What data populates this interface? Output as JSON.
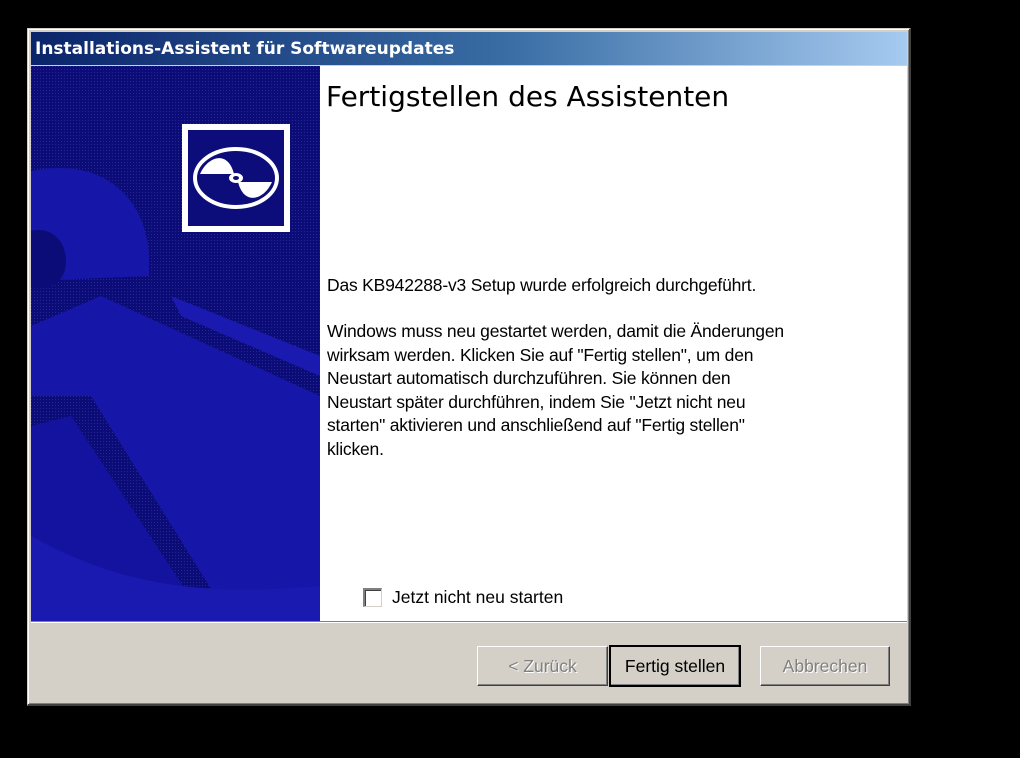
{
  "window": {
    "title": "Installations-Assistent für Softwareupdates"
  },
  "banner": {
    "icon": "cd-disc-icon",
    "background_color": "#0c0c7a"
  },
  "content": {
    "heading": "Fertigstellen des Assistenten",
    "success_message": "Das KB942288-v3 Setup wurde erfolgreich durchgeführt.",
    "restart_message_lines": [
      "Windows muss neu gestartet werden, damit die Änderungen",
      "wirksam werden. Klicken Sie auf \"Fertig stellen\", um den",
      "Neustart automatisch durchzuführen. Sie können den",
      "Neustart später durchführen, indem Sie \"Jetzt nicht neu",
      "starten\" aktivieren und anschließend auf \"Fertig stellen\"",
      "klicken."
    ],
    "checkbox": {
      "label": "Jetzt nicht neu starten",
      "checked": false
    }
  },
  "buttons": {
    "back_label": "< Zurück",
    "finish_label": "Fertig stellen",
    "cancel_label": "Abbrechen"
  },
  "colors": {
    "titlebar_start": "#0a246a",
    "titlebar_end": "#a6caf0",
    "dialog_face": "#d4d0c8"
  }
}
